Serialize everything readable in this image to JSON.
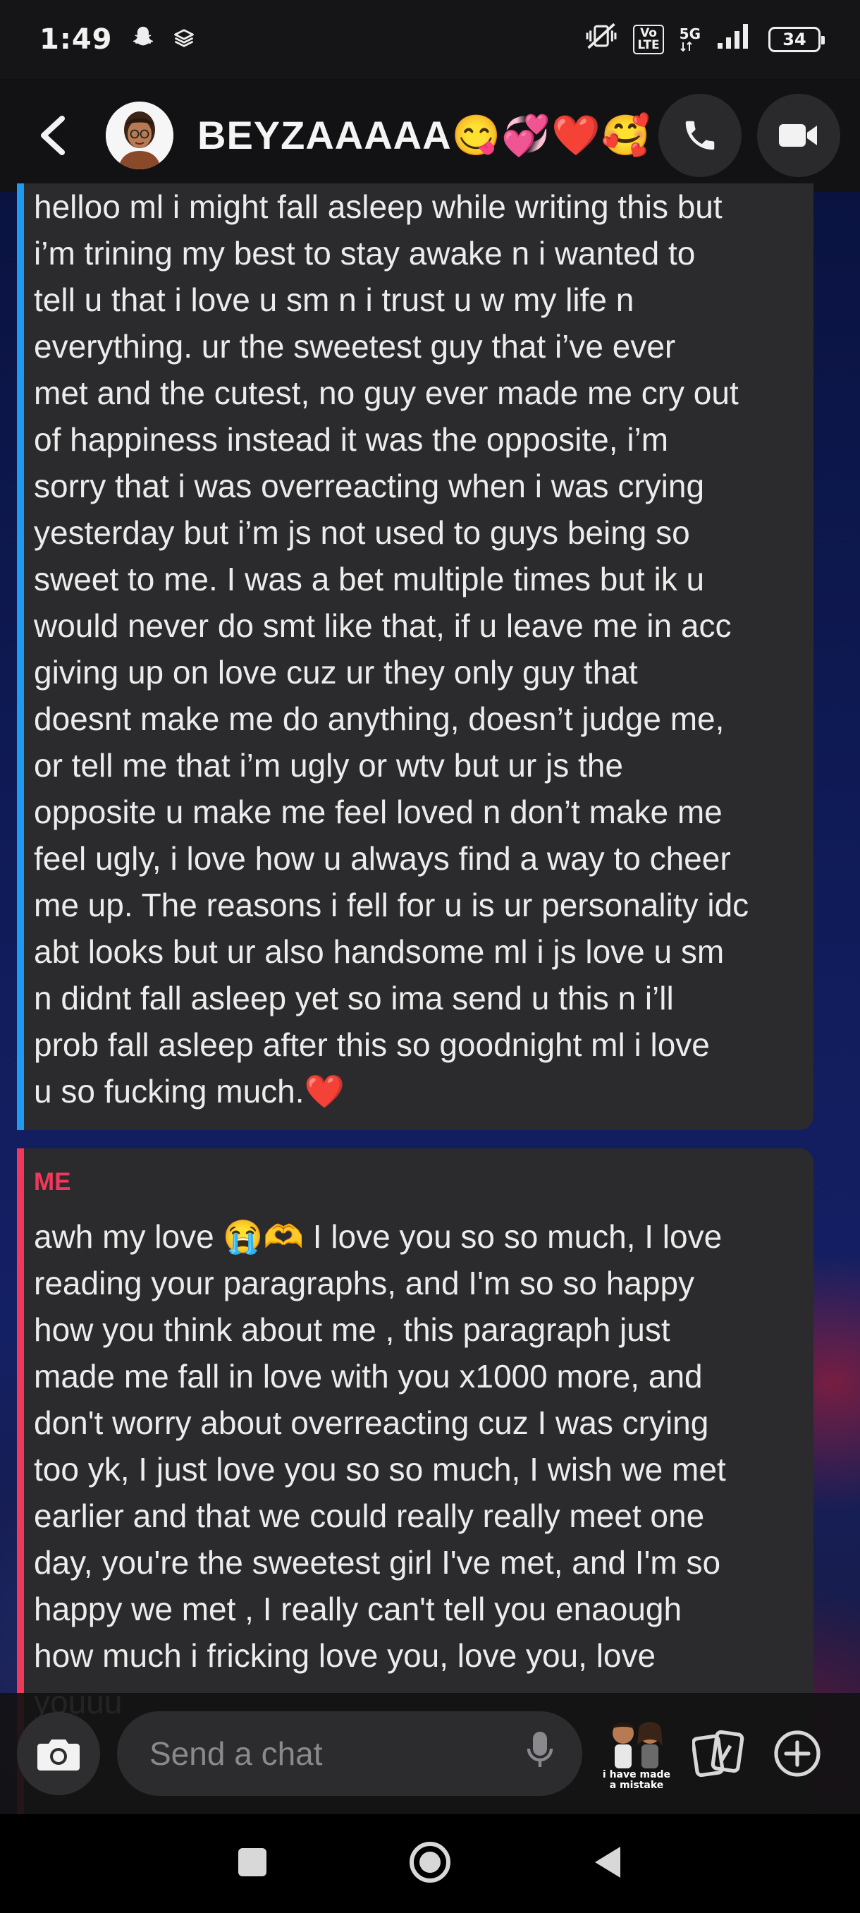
{
  "status_bar": {
    "time": "1:49",
    "network": "5G",
    "volte": "Vo\nLTE",
    "battery": "34"
  },
  "header": {
    "contact_name": "BEYZAAAAA😋💞❤️🥰",
    "call_icon": "phone-icon",
    "video_icon": "video-camera-icon"
  },
  "messages": [
    {
      "sender": "",
      "bar_color": "#1e9af0",
      "text": "helloo ml i might fall asleep while writing this but\ni’m trining my best to stay awake n i wanted to\ntell u that i love u sm n i trust u w my life n\neverything. ur the sweetest guy that i’ve ever\nmet and the cutest, no guy ever made me cry out\nof happiness instead it was the opposite, i’m\nsorry that i was overreacting when i was crying\nyesterday but i’m js not used to guys being so\nsweet to me. I was a bet multiple times but ik u\nwould never do smt like that, if u leave me in acc\ngiving up on love cuz ur they only guy that\ndoesnt make me do anything, doesn’t judge me,\nor tell me that i’m  ugly or wtv but ur js the\nopposite u make me feel loved n don’t make me\nfeel ugly, i love how u always find a way to cheer\nme up. The reasons i fell for u is ur personality idc\nabt looks but ur also handsome ml i js love u sm\nn didnt fall asleep yet so ima send u this n i’ll\nprob fall asleep after this so goodnight ml i love\nu so fucking much.❤️"
    },
    {
      "sender": "ME",
      "bar_color": "#f0385a",
      "text": "awh my love 😭🫶 I love you so so much, I love\nreading your paragraphs, and I'm so so happy\nhow you think about me , this paragraph just\nmade me fall in love with you x1000 more, and\ndon't worry about overreacting cuz I was crying\ntoo yk, I just love you so so much, I wish we met\nearlier and that we could really really meet one\nday, you're the sweetest girl I've met, and I'm so\nhappy we met , I really can't tell you enaough\nhow much i fricking love you, love you, love\nyouuu"
    }
  ],
  "chat_bar": {
    "placeholder": "Send a chat",
    "bitmoji_caption": "i have made\na mistake"
  }
}
